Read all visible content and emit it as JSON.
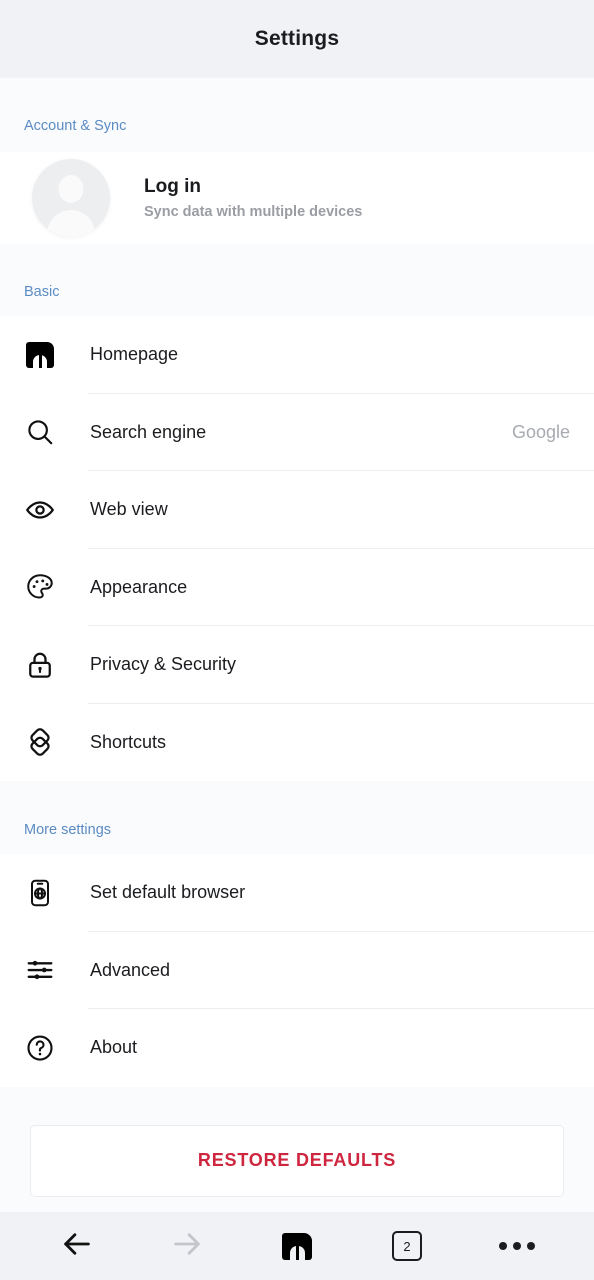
{
  "header": {
    "title": "Settings"
  },
  "sections": {
    "account": {
      "header_label": "Account & Sync",
      "login_title": "Log in",
      "login_subtitle": "Sync data with multiple devices"
    },
    "basic": {
      "header_label": "Basic",
      "items": [
        {
          "label": "Homepage",
          "value": "",
          "icon": "maxthon-logo-icon"
        },
        {
          "label": "Search engine",
          "value": "Google",
          "icon": "search-icon"
        },
        {
          "label": "Web view",
          "value": "",
          "icon": "eye-icon"
        },
        {
          "label": "Appearance",
          "value": "",
          "icon": "palette-icon"
        },
        {
          "label": "Privacy & Security",
          "value": "",
          "icon": "lock-icon"
        },
        {
          "label": "Shortcuts",
          "value": "",
          "icon": "shortcuts-icon"
        }
      ]
    },
    "more": {
      "header_label": "More settings",
      "items": [
        {
          "label": "Set default browser",
          "value": "",
          "icon": "phone-globe-icon"
        },
        {
          "label": "Advanced",
          "value": "",
          "icon": "sliders-icon"
        },
        {
          "label": "About",
          "value": "",
          "icon": "question-circle-icon"
        }
      ]
    }
  },
  "restore": {
    "label": "RESTORE DEFAULTS"
  },
  "bottom_bar": {
    "back_icon": "arrow-left-icon",
    "forward_icon": "arrow-right-icon",
    "home_icon": "maxthon-logo-icon",
    "tab_count": "2",
    "menu_icon": "more-dots-icon"
  },
  "colors": {
    "header_bg": "#f1f2f5",
    "section_header_text": "#5b8bc4",
    "restore_text": "#cf2640",
    "value_text": "#a7aab0",
    "label_text": "#1b1c1f"
  }
}
